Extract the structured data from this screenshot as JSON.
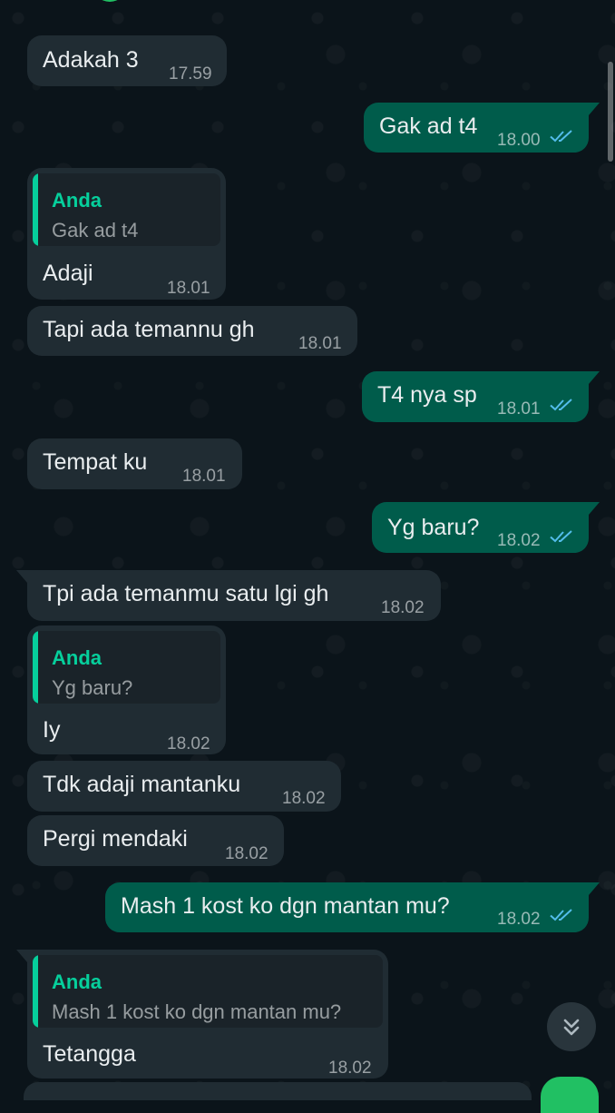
{
  "colors": {
    "chat_background": "#0b141a",
    "incoming_bubble": "#202c33",
    "outgoing_bubble": "#005c4b",
    "quote_accent": "#06cf9c",
    "read_ticks": "#53bdeb",
    "fab_green": "#21c063"
  },
  "messages": [
    {
      "direction": "in",
      "text": "Adakah 3",
      "time": "17.59"
    },
    {
      "direction": "out",
      "text": "Gak ad t4",
      "time": "18.00",
      "status": "read"
    },
    {
      "direction": "in",
      "quoted_author": "Anda",
      "quoted_text": "Gak ad t4",
      "text": "Adaji",
      "time": "18.01"
    },
    {
      "direction": "in",
      "text": "Tapi ada temannu gh",
      "time": "18.01"
    },
    {
      "direction": "out",
      "text": "T4 nya sp",
      "time": "18.01",
      "status": "read"
    },
    {
      "direction": "in",
      "text": "Tempat ku",
      "time": "18.01"
    },
    {
      "direction": "out",
      "text": "Yg baru?",
      "time": "18.02",
      "status": "read"
    },
    {
      "direction": "in",
      "text": "Tpi ada temanmu satu lgi gh",
      "time": "18.02"
    },
    {
      "direction": "in",
      "quoted_author": "Anda",
      "quoted_text": "Yg baru?",
      "text": "Iy",
      "time": "18.02"
    },
    {
      "direction": "in",
      "text": "Tdk adaji mantanku",
      "time": "18.02"
    },
    {
      "direction": "in",
      "text": "Pergi mendaki",
      "time": "18.02"
    },
    {
      "direction": "out",
      "text": "Mash 1 kost ko dgn mantan mu?",
      "time": "18.02",
      "status": "read"
    },
    {
      "direction": "in",
      "quoted_author": "Anda",
      "quoted_text": "Mash 1 kost ko dgn mantan mu?",
      "text": "Tetangga",
      "time": "18.02"
    }
  ],
  "icons": {
    "read_receipt": "double-check-icon",
    "scroll_to_bottom": "chevron-double-down-icon"
  }
}
